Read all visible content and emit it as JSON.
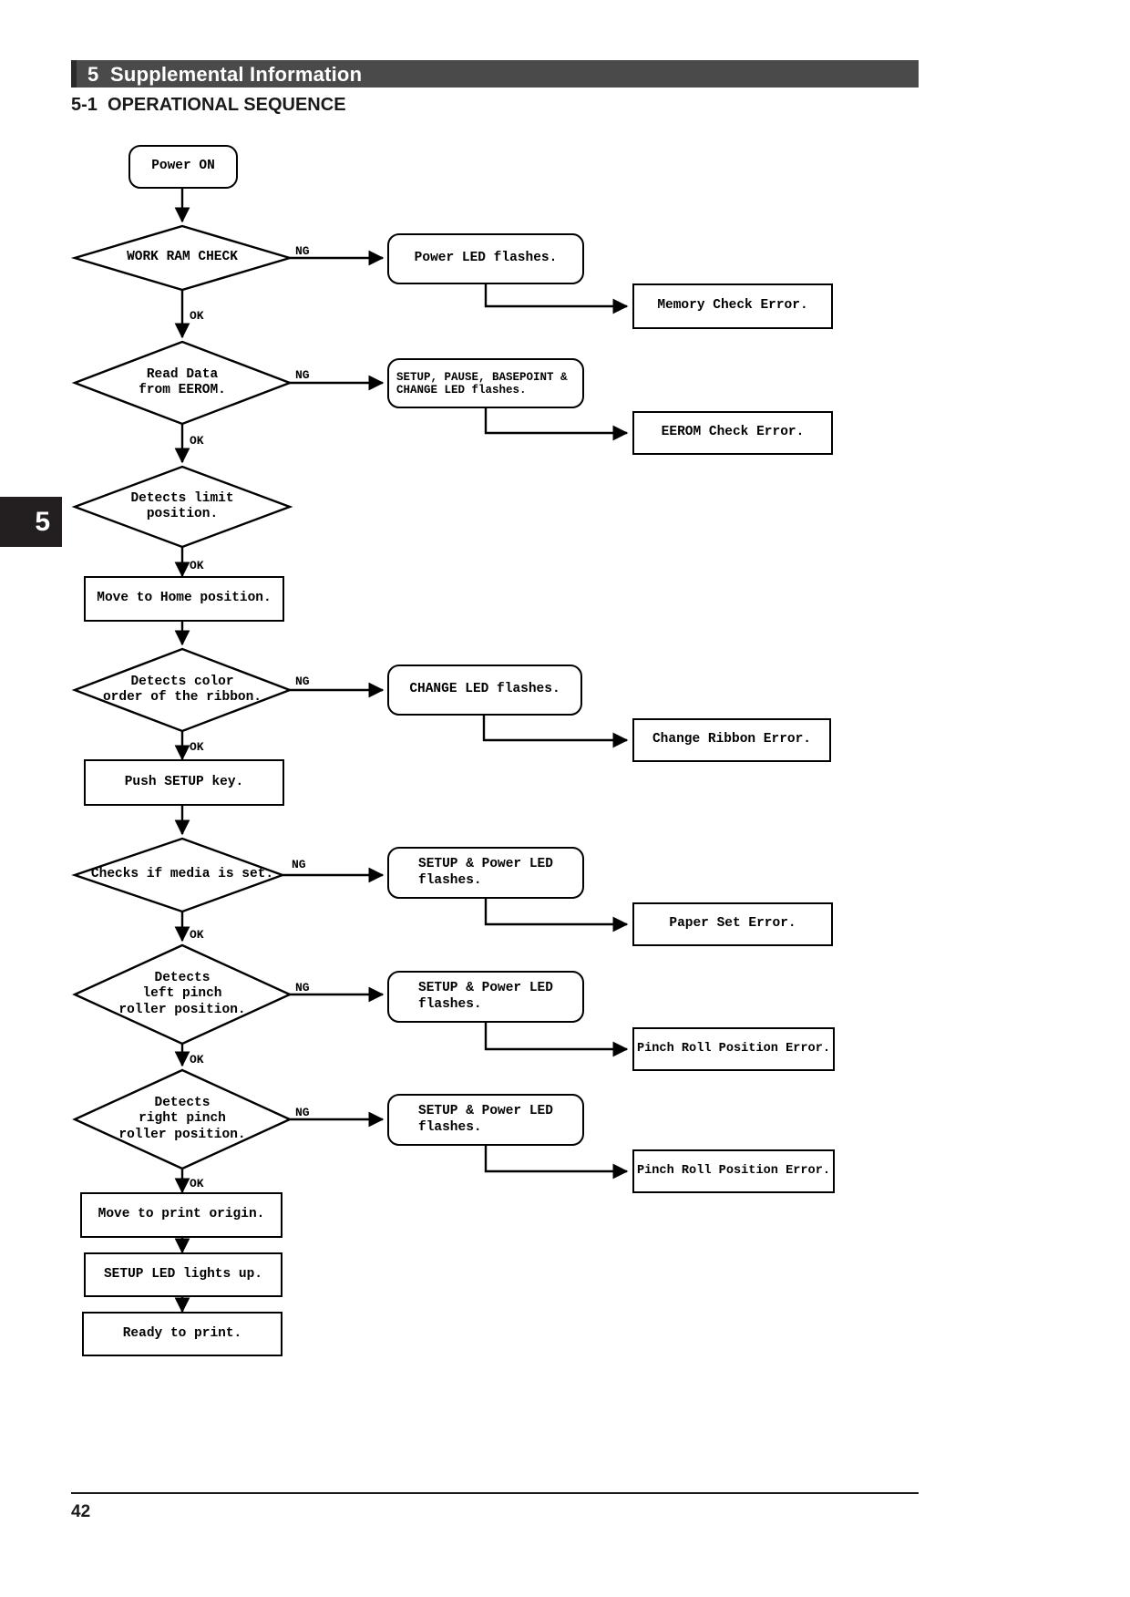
{
  "header": {
    "chapter_number": "5",
    "chapter_title": "5  Supplemental Information",
    "section_title": "5-1  OPERATIONAL SEQUENCE"
  },
  "side_tab": {
    "label": "5"
  },
  "footer": {
    "page_number": "42"
  },
  "flowchart": {
    "title": "Operational sequence",
    "edge_label_ok": "OK",
    "edge_label_ng": "NG",
    "nodes": {
      "power_on": "Power ON",
      "work_ram_check": "WORK RAM CHECK",
      "power_led_flashes": "Power LED flashes.",
      "memory_check_error": "Memory Check Error.",
      "read_data_eerom": "Read Data\nfrom EEROM.",
      "setup_pause_basepoint_change_led": "SETUP, PAUSE, BASEPOINT &\nCHANGE LED flashes.",
      "eerom_check_error": "EEROM Check Error.",
      "detects_limit_position": "Detects limit\nposition.",
      "move_to_home_position": "Move to Home position.",
      "detects_color_order": "Detects color\norder of the ribbon.",
      "change_led_flashes": "CHANGE LED flashes.",
      "change_ribbon_error": "Change Ribbon Error.",
      "push_setup_key": "Push SETUP key.",
      "checks_media_set": "Checks if media is set.",
      "setup_power_led_flashes_media": "SETUP & Power LED\nflashes.",
      "paper_set_error": "Paper Set Error.",
      "detects_left_pinch": "Detects\nleft pinch\nroller position.",
      "setup_power_led_flashes_left": "SETUP & Power LED\nflashes.",
      "pinch_roll_position_error_left": "Pinch Roll Position Error.",
      "detects_right_pinch": "Detects\nright pinch\nroller position.",
      "setup_power_led_flashes_right": "SETUP & Power LED\nflashes.",
      "pinch_roll_position_error_right": "Pinch Roll Position Error.",
      "move_to_print_origin": "Move to print origin.",
      "setup_led_lights_up": "SETUP LED lights up.",
      "ready_to_print": "Ready to print."
    }
  },
  "colors": {
    "chapter_bar": "#4a4a4a",
    "chapter_bar_accent": "#2b2b2b",
    "side_tab": "#231f20",
    "ink": "#000000",
    "paper": "#ffffff"
  }
}
